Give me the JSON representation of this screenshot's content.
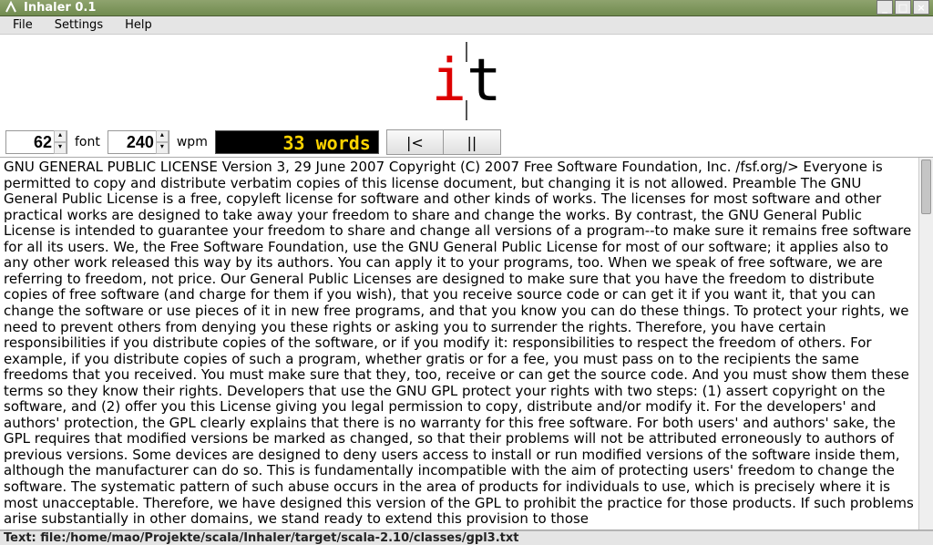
{
  "window": {
    "title": "Inhaler 0.1"
  },
  "menubar": {
    "items": [
      "File",
      "Settings",
      "Help"
    ]
  },
  "reader": {
    "word_pre": "",
    "word_orp": "i",
    "word_post": "t"
  },
  "controls": {
    "font_value": "62",
    "font_label": "font",
    "wpm_value": "240",
    "wpm_label": "wpm",
    "lcd_text": "33 words",
    "restart_glyph": "|<",
    "pause_glyph": "||"
  },
  "document": {
    "body": "GNU GENERAL PUBLIC LICENSE Version 3, 29 June 2007 Copyright (C) 2007 Free Software Foundation, Inc. /fsf.org/> Everyone is permitted to copy and distribute verbatim copies of this license document, but changing it is not allowed. Preamble The GNU General Public License is a free, copyleft license for software and other kinds of works. The licenses for most software and other practical works are designed to take away your freedom to share and change the works. By contrast, the GNU General Public License is intended to guarantee your freedom to share and change all versions of a program--to make sure it remains free software for all its users. We, the Free Software Foundation, use the GNU General Public License for most of our software; it applies also to any other work released this way by its authors. You can apply it to your programs, too. When we speak of free software, we are referring to freedom, not price. Our General Public Licenses are designed to make sure that you have the freedom to distribute copies of free software (and charge for them if you wish), that you receive source code or can get it if you want it, that you can change the software or use pieces of it in new free programs, and that you know you can do these things. To protect your rights, we need to prevent others from denying you these rights or asking you to surrender the rights. Therefore, you have certain responsibilities if you distribute copies of the software, or if you modify it: responsibilities to respect the freedom of others. For example, if you distribute copies of such a program, whether gratis or for a fee, you must pass on to the recipients the same freedoms that you received. You must make sure that they, too, receive or can get the source code. And you must show them these terms so they know their rights. Developers that use the GNU GPL protect your rights with two steps: (1) assert copyright on the software, and (2) offer you this License giving you legal permission to copy, distribute and/or modify it. For the developers' and authors' protection, the GPL clearly explains that there is no warranty for this free software. For both users' and authors' sake, the GPL requires that modified versions be marked as changed, so that their problems will not be attributed erroneously to authors of previous versions. Some devices are designed to deny users access to install or run modified versions of the software inside them, although the manufacturer can do so. This is fundamentally incompatible with the aim of protecting users' freedom to change the software. The systematic pattern of such abuse occurs in the area of products for individuals to use, which is precisely where it is most unacceptable. Therefore, we have designed this version of the GPL to prohibit the practice for those products. If such problems arise substantially in other domains, we stand ready to extend this provision to those"
  },
  "statusbar": {
    "text": "Text: file:/home/mao/Projekte/scala/Inhaler/target/scala-2.10/classes/gpl3.txt"
  }
}
